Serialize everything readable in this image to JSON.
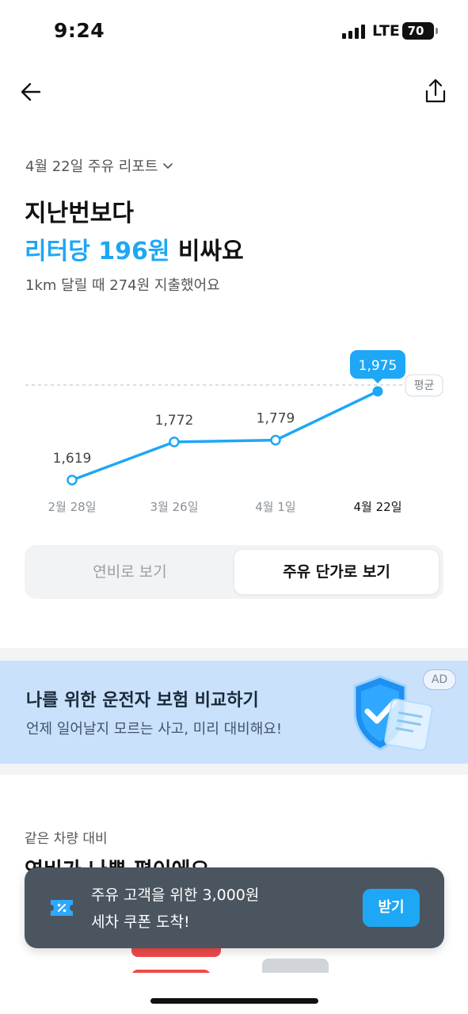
{
  "status_bar": {
    "time": "9:24",
    "network": "LTE",
    "battery": "70"
  },
  "nav": {
    "back_icon": "arrow-left-icon",
    "share_icon": "share-icon"
  },
  "report": {
    "selector_label": "4월 22일 주유 리포트"
  },
  "headline": {
    "line1": "지난번보다",
    "highlight": "리터당 196원",
    "suffix": " 비싸요",
    "subline": "1km 달릴 때 274원 지출했어요"
  },
  "chart_data": {
    "type": "line",
    "categories": [
      "2월 28일",
      "3월 26일",
      "4월 1일",
      "4월 22일"
    ],
    "values": [
      1619,
      1772,
      1779,
      1975
    ],
    "value_labels": [
      "1,619",
      "1,772",
      "1,779",
      "1,975"
    ],
    "highlight_index": 3,
    "average_label": "평균",
    "accent_color": "#1ea7f5"
  },
  "view_toggle": {
    "options": [
      {
        "label": "연비로 보기",
        "active": false
      },
      {
        "label": "주유 단가로 보기",
        "active": true
      }
    ]
  },
  "ad": {
    "title": "나를 위한 운전자 보험 비교하기",
    "subtitle": "언제 일어날지 모르는 사고, 미리 대비해요!",
    "badge": "AD",
    "illustration_icon": "shield-check-icon"
  },
  "compare": {
    "label": "같은 차량 대비",
    "title": "연비가 나쁜 편이에요"
  },
  "toast": {
    "icon": "coupon-icon",
    "line1": "주유 고객을 위한 3,000원",
    "line2": "세차 쿠폰 도착!",
    "button": "받기"
  }
}
